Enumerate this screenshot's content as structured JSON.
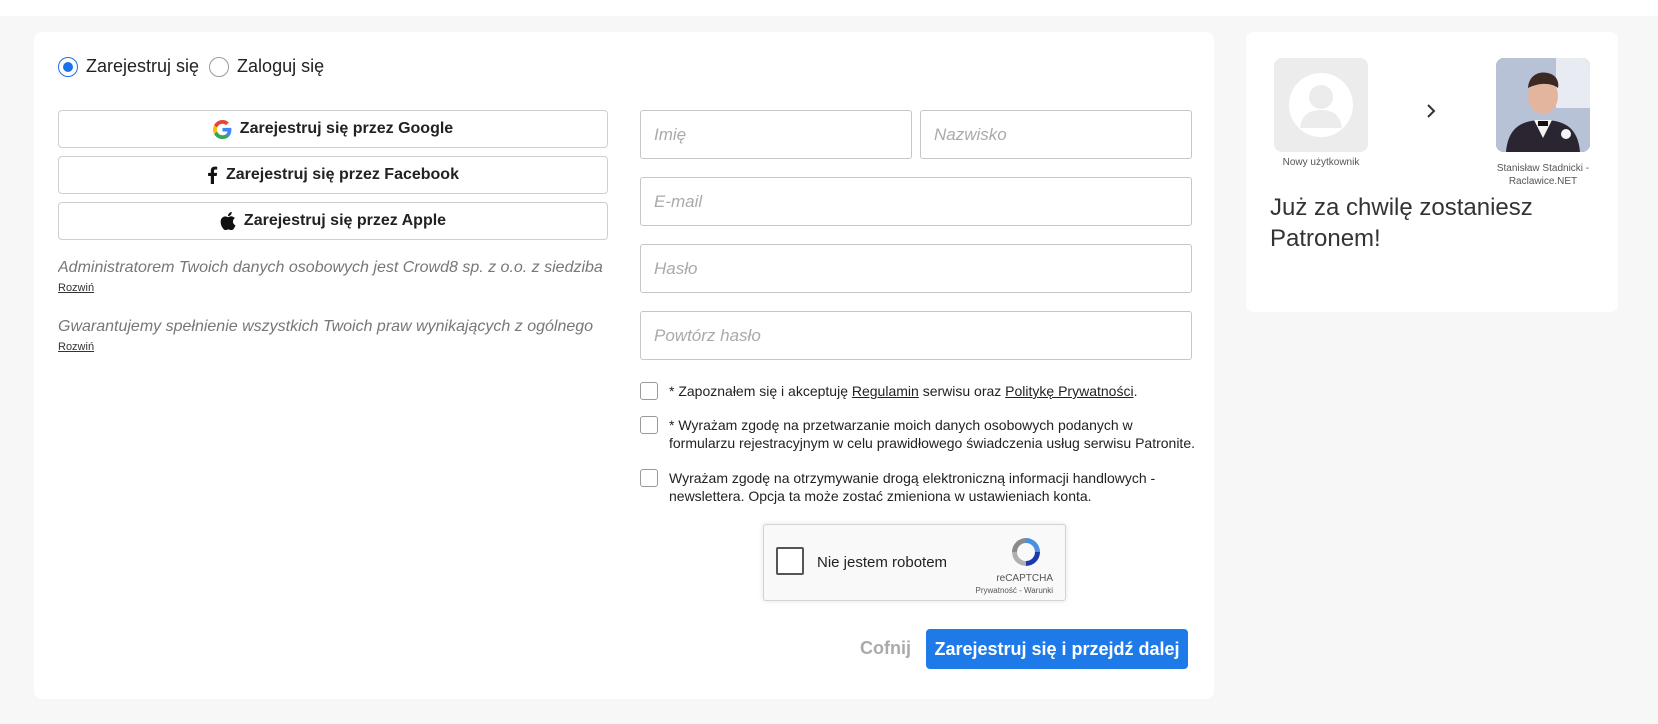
{
  "mode": {
    "register_label": "Zarejestruj się",
    "login_label": "Zaloguj się",
    "selected": "register"
  },
  "social": {
    "google_label": "Zarejestruj się przez Google",
    "facebook_label": "Zarejestruj się przez Facebook",
    "apple_label": "Zarejestruj się przez Apple"
  },
  "legal": [
    {
      "text": "Administratorem Twoich danych osobowych jest Crowd8 sp. z o.o. z siedziba w",
      "more": "Rozwiń"
    },
    {
      "text": "Gwarantujemy spełnienie wszystkich Twoich praw wynikających z ogólnego",
      "more": "Rozwiń"
    }
  ],
  "form": {
    "first_name_placeholder": "Imię",
    "last_name_placeholder": "Nazwisko",
    "email_placeholder": "E-mail",
    "password_placeholder": "Hasło",
    "password_repeat_placeholder": "Powtórz hasło"
  },
  "consents": {
    "terms_prefix": "* Zapoznałem się i akceptuję ",
    "terms_link": "Regulamin",
    "terms_middle": " serwisu oraz ",
    "privacy_link": "Politykę Prywatności",
    "terms_suffix": ".",
    "data_processing": "* Wyrażam zgodę na przetwarzanie moich danych osobowych podanych w formularzu rejestracyjnym w celu prawidłowego świadczenia usług serwisu Patronite.",
    "newsletter": "Wyrażam zgodę na otrzymywanie drogą elektroniczną informacji handlowych - newslettera. Opcja ta może zostać zmieniona w ustawieniach konta."
  },
  "recaptcha": {
    "label": "Nie jestem robotem",
    "brand": "reCAPTCHA",
    "links": "Prywatność - Warunki"
  },
  "actions": {
    "back_label": "Cofnij",
    "submit_label": "Zarejestruj się i przejdź dalej"
  },
  "side": {
    "new_user_caption": "Nowy użytkownik",
    "creator_caption": "Stanisław Stadnicki - Raclawice.NET",
    "heading": "Już za chwilę zostaniesz Patronem!"
  },
  "colors": {
    "accent": "#1f7ae9",
    "page_bg": "#f7f7f7"
  }
}
